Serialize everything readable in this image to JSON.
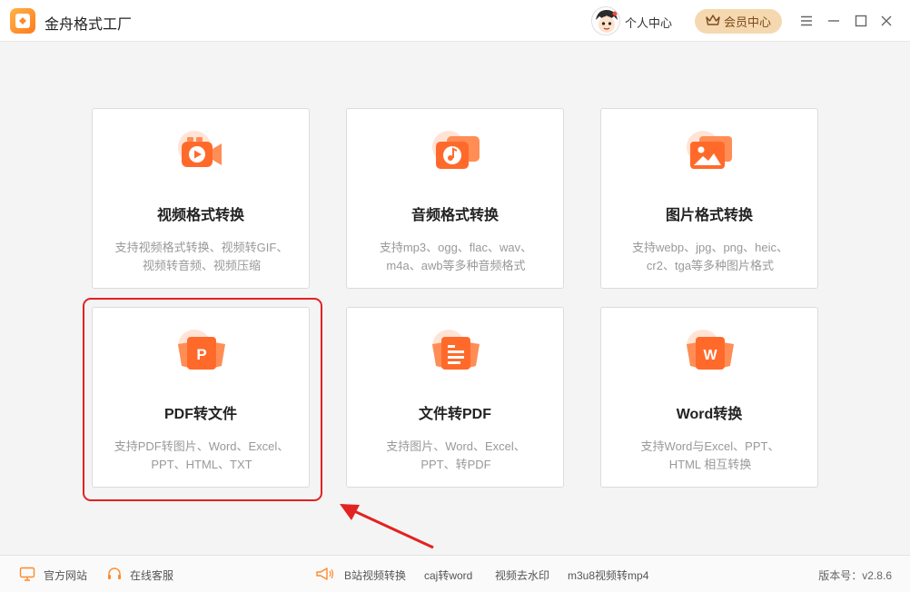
{
  "app": {
    "title": "金舟格式工厂"
  },
  "header": {
    "personal_center": "个人中心",
    "vip": "会员中心"
  },
  "cards": [
    {
      "title": "视频格式转换",
      "desc_line1": "支持视频格式转换、视频转GIF、",
      "desc_line2": "视频转音频、视频压缩",
      "icon": "video-icon"
    },
    {
      "title": "音频格式转换",
      "desc_line1": "支持mp3、ogg、flac、wav、",
      "desc_line2": "m4a、awb等多种音频格式",
      "icon": "audio-icon"
    },
    {
      "title": "图片格式转换",
      "desc_line1": "支持webp、jpg、png、heic、",
      "desc_line2": "cr2、tga等多种图片格式",
      "icon": "image-icon"
    },
    {
      "title": "PDF转文件",
      "desc_line1": "支持PDF转图片、Word、Excel、",
      "desc_line2": "PPT、HTML、TXT",
      "icon": "pdf-icon"
    },
    {
      "title": "文件转PDF",
      "desc_line1": "支持图片、Word、Excel、",
      "desc_line2": "PPT、转PDF",
      "icon": "file-to-pdf-icon"
    },
    {
      "title": "Word转换",
      "desc_line1": "支持Word与Excel、PPT、",
      "desc_line2": "HTML 相互转换",
      "icon": "word-icon"
    }
  ],
  "footer": {
    "website": "官方网站",
    "service": "在线客服",
    "links": [
      "B站视频转换",
      "caj转word",
      "视频去水印",
      "m3u8视频转mp4"
    ],
    "version": "版本号：v2.8.6"
  },
  "colors": {
    "accent": "#ff6a2b",
    "highlight": "#e32222",
    "vip_bg": "#f6d8b0"
  }
}
